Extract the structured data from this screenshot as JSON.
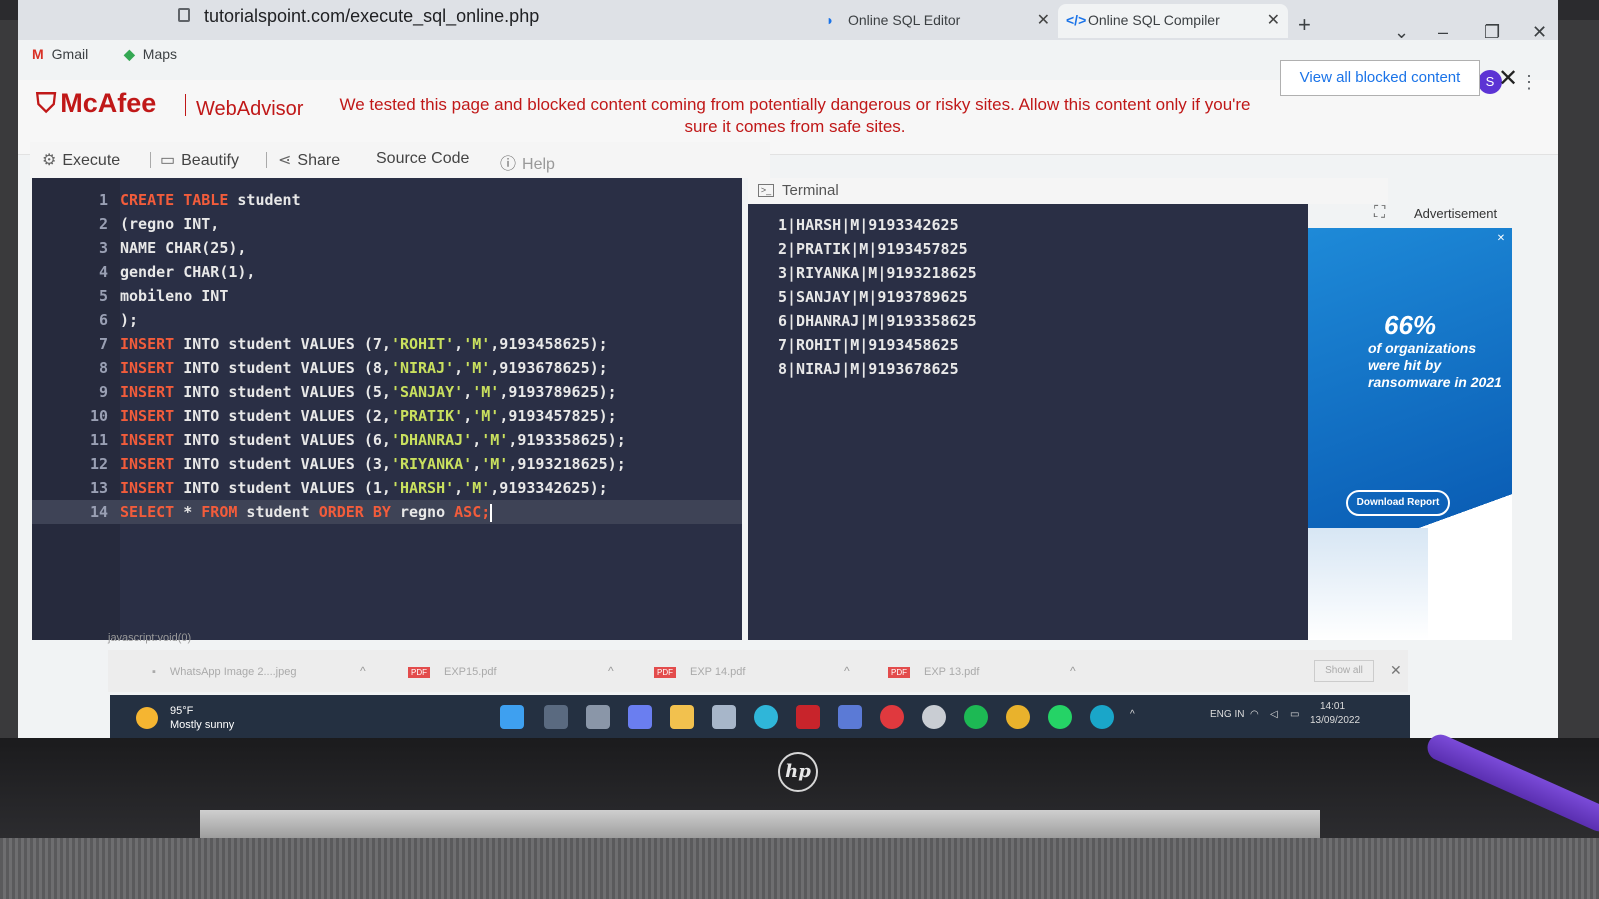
{
  "browser": {
    "url": "tutorialspoint.com/execute_sql_online.php",
    "tabs": [
      {
        "title": "Online SQL Editor"
      },
      {
        "title": "Online SQL Compiler"
      }
    ],
    "bookmarks": [
      {
        "label": "Gmail",
        "icon": "gmail-icon"
      },
      {
        "label": "Maps",
        "icon": "maps-icon"
      }
    ],
    "profile_initial": "S"
  },
  "mcafee": {
    "brand": "McAfee",
    "product": "WebAdvisor",
    "message": "We tested this page and blocked content coming from potentially dangerous or risky sites. Allow this content only if you're sure it comes from safe sites.",
    "view_blocked_label": "View all blocked content",
    "brand_color": "#c01818"
  },
  "editor_toolbar": {
    "execute": "Execute",
    "beautify": "Beautify",
    "share": "Share",
    "source_code": "Source Code",
    "help": "Help"
  },
  "editor": {
    "lines": [
      {
        "n": "1",
        "tokens": [
          {
            "t": "CREATE TABLE",
            "c": "kw"
          },
          {
            "t": " student",
            "c": ""
          }
        ]
      },
      {
        "n": "2",
        "tokens": [
          {
            "t": "(regno INT,",
            "c": ""
          }
        ]
      },
      {
        "n": "3",
        "tokens": [
          {
            "t": "NAME CHAR(25),",
            "c": ""
          }
        ]
      },
      {
        "n": "4",
        "tokens": [
          {
            "t": "gender CHAR(1),",
            "c": ""
          }
        ]
      },
      {
        "n": "5",
        "tokens": [
          {
            "t": "mobileno INT",
            "c": ""
          }
        ]
      },
      {
        "n": "6",
        "tokens": [
          {
            "t": ");",
            "c": ""
          }
        ]
      },
      {
        "n": "7",
        "tokens": [
          {
            "t": "INSERT",
            "c": "kw"
          },
          {
            "t": " INTO student VALUES (7,",
            "c": ""
          },
          {
            "t": "'ROHIT'",
            "c": "str"
          },
          {
            "t": ",",
            "c": ""
          },
          {
            "t": "'M'",
            "c": "str"
          },
          {
            "t": ",9193458625);",
            "c": ""
          }
        ]
      },
      {
        "n": "8",
        "tokens": [
          {
            "t": "INSERT",
            "c": "kw"
          },
          {
            "t": " INTO student VALUES (8,",
            "c": ""
          },
          {
            "t": "'NIRAJ'",
            "c": "str"
          },
          {
            "t": ",",
            "c": ""
          },
          {
            "t": "'M'",
            "c": "str"
          },
          {
            "t": ",9193678625);",
            "c": ""
          }
        ]
      },
      {
        "n": "9",
        "tokens": [
          {
            "t": "INSERT",
            "c": "kw"
          },
          {
            "t": " INTO student VALUES (5,",
            "c": ""
          },
          {
            "t": "'SANJAY'",
            "c": "str"
          },
          {
            "t": ",",
            "c": ""
          },
          {
            "t": "'M'",
            "c": "str"
          },
          {
            "t": ",9193789625);",
            "c": ""
          }
        ]
      },
      {
        "n": "10",
        "tokens": [
          {
            "t": "INSERT",
            "c": "kw"
          },
          {
            "t": " INTO student VALUES (2,",
            "c": ""
          },
          {
            "t": "'PRATIK'",
            "c": "str"
          },
          {
            "t": ",",
            "c": ""
          },
          {
            "t": "'M'",
            "c": "str"
          },
          {
            "t": ",9193457825);",
            "c": ""
          }
        ]
      },
      {
        "n": "11",
        "tokens": [
          {
            "t": "INSERT",
            "c": "kw"
          },
          {
            "t": " INTO student VALUES (6,",
            "c": ""
          },
          {
            "t": "'DHANRAJ'",
            "c": "str"
          },
          {
            "t": ",",
            "c": ""
          },
          {
            "t": "'M'",
            "c": "str"
          },
          {
            "t": ",9193358625);",
            "c": ""
          }
        ]
      },
      {
        "n": "12",
        "tokens": [
          {
            "t": "INSERT",
            "c": "kw"
          },
          {
            "t": " INTO student VALUES (3,",
            "c": ""
          },
          {
            "t": "'RIYANKA'",
            "c": "str"
          },
          {
            "t": ",",
            "c": ""
          },
          {
            "t": "'M'",
            "c": "str"
          },
          {
            "t": ",9193218625);",
            "c": ""
          }
        ]
      },
      {
        "n": "13",
        "tokens": [
          {
            "t": "INSERT",
            "c": "kw"
          },
          {
            "t": " INTO student VALUES (1,",
            "c": ""
          },
          {
            "t": "'HARSH'",
            "c": "str"
          },
          {
            "t": ",",
            "c": ""
          },
          {
            "t": "'M'",
            "c": "str"
          },
          {
            "t": ",9193342625);",
            "c": ""
          }
        ]
      },
      {
        "n": "14",
        "tokens": [
          {
            "t": "SELECT",
            "c": "kw"
          },
          {
            "t": " * ",
            "c": ""
          },
          {
            "t": "FROM",
            "c": "kw"
          },
          {
            "t": " student ",
            "c": ""
          },
          {
            "t": "ORDER BY",
            "c": "kw"
          },
          {
            "t": " regno ",
            "c": ""
          },
          {
            "t": "ASC;",
            "c": "kw"
          }
        ],
        "current": true
      }
    ],
    "status_url": "javascript:void(0)"
  },
  "terminal": {
    "title": "Terminal",
    "output": [
      "1|HARSH|M|9193342625",
      "2|PRATIK|M|9193457825",
      "3|RIYANKA|M|9193218625",
      "5|SANJAY|M|9193789625",
      "6|DHANRAJ|M|9193358625",
      "7|ROHIT|M|9193458625",
      "8|NIRAJ|M|9193678625"
    ]
  },
  "ad": {
    "label": "Advertisement",
    "percent": "66%",
    "text": "of organizations were hit by ransomware in 2021",
    "button": "Download Report"
  },
  "downloads": {
    "items": [
      {
        "name": "WhatsApp Image 2....jpeg",
        "type": "image"
      },
      {
        "name": "EXP15.pdf",
        "type": "pdf"
      },
      {
        "name": "EXP 14.pdf",
        "type": "pdf"
      },
      {
        "name": "EXP 13.pdf",
        "type": "pdf"
      }
    ],
    "show_all": "Show all"
  },
  "taskbar": {
    "temperature": "95°F",
    "weather": "Mostly sunny",
    "language": "ENG IN",
    "time": "14:01",
    "date": "13/09/2022"
  },
  "device": {
    "brand": "hp"
  }
}
